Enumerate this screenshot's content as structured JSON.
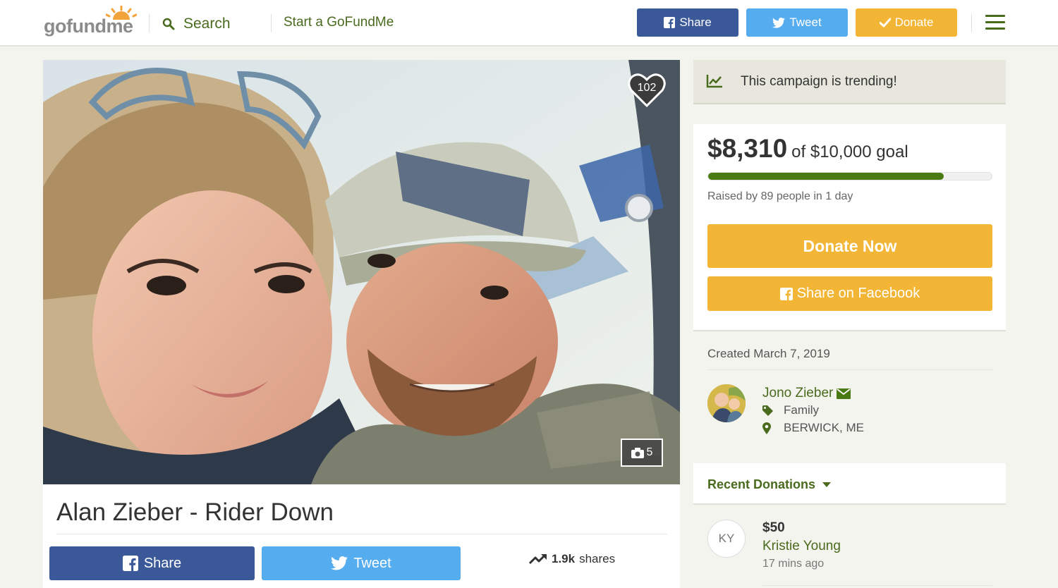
{
  "header": {
    "logo": "gofundme",
    "search_label": "Search",
    "start_label": "Start a GoFundMe",
    "share_label": "Share",
    "tweet_label": "Tweet",
    "donate_label": "Donate"
  },
  "photo": {
    "heart_count": "102",
    "photo_count": "5"
  },
  "campaign": {
    "title": "Alan Zieber - Rider Down",
    "share_label": "Share",
    "tweet_label": "Tweet",
    "shares_count": "1.9k",
    "shares_label": "shares"
  },
  "sidebar": {
    "trending_text": "This campaign is trending!",
    "raised_amount": "$8,310",
    "goal_text": "of $10,000 goal",
    "progress_fraction": 0.831,
    "raised_by": "Raised by 89 people in 1 day",
    "donate_now_label": "Donate Now",
    "share_facebook_label": "Share on Facebook",
    "created": "Created March 7, 2019",
    "organizer_name": "Jono Zieber",
    "category": "Family",
    "location": "BERWICK, ME",
    "recent_donations_label": "Recent Donations",
    "donations": [
      {
        "initials": "KY",
        "amount": "$50",
        "name": "Kristie Young",
        "time": "17 mins ago"
      }
    ]
  },
  "colors": {
    "brand_green": "#4a6a1e",
    "facebook_blue": "#3b5998",
    "twitter_blue": "#55acee",
    "donate_orange": "#f3b536"
  },
  "icons": [
    "search-icon",
    "facebook-icon",
    "twitter-icon",
    "check-icon",
    "menu-icon",
    "heart-icon",
    "camera-icon",
    "trending-icon",
    "envelope-icon",
    "tag-icon",
    "location-icon",
    "caret-down-icon"
  ]
}
